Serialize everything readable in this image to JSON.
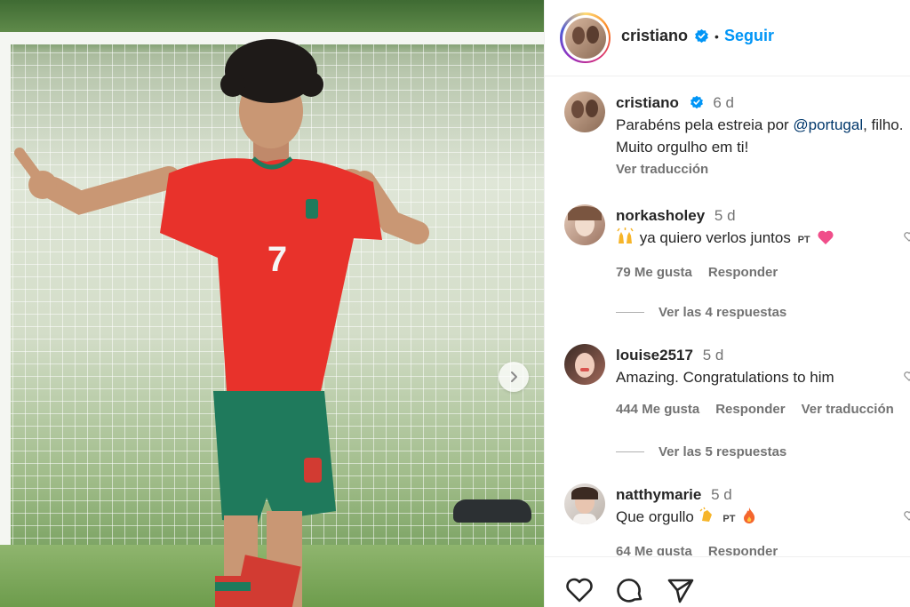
{
  "post": {
    "author": "cristiano",
    "follow_label": "Seguir",
    "separator": "•"
  },
  "caption": {
    "username": "cristiano",
    "time": "6 d",
    "text_before": "Parabéns pela estreia por ",
    "mention": "@portugal",
    "text_after": ", filho. Muito orgulho em ti!",
    "translate_label": "Ver traducción"
  },
  "comments": [
    {
      "username": "norkasholey",
      "time": "5 d",
      "text": "ya quiero verlos juntos",
      "flag_text": "PT",
      "likes": "79 Me gusta",
      "reply_label": "Responder",
      "replies_label": "Ver las 4 respuestas"
    },
    {
      "username": "louise2517",
      "time": "5 d",
      "text": "Amazing. Congratulations to him",
      "likes": "444 Me gusta",
      "reply_label": "Responder",
      "translate_label": "Ver traducción",
      "replies_label": "Ver las 5 respuestas"
    },
    {
      "username": "natthymarie",
      "time": "5 d",
      "text": "Que orgullo",
      "flag_text": "PT",
      "likes": "64 Me gusta",
      "reply_label": "Responder"
    }
  ],
  "jersey_number": "7",
  "icons": {
    "verified": "verified-badge-icon",
    "next": "chevron-right-icon",
    "like": "heart-icon",
    "comment": "comment-icon",
    "share": "share-icon"
  },
  "colors": {
    "accent": "#0095f6",
    "verified": "#0095f6",
    "mention": "#00376b",
    "jersey": "#e8322b",
    "shorts": "#1f7a5c"
  }
}
